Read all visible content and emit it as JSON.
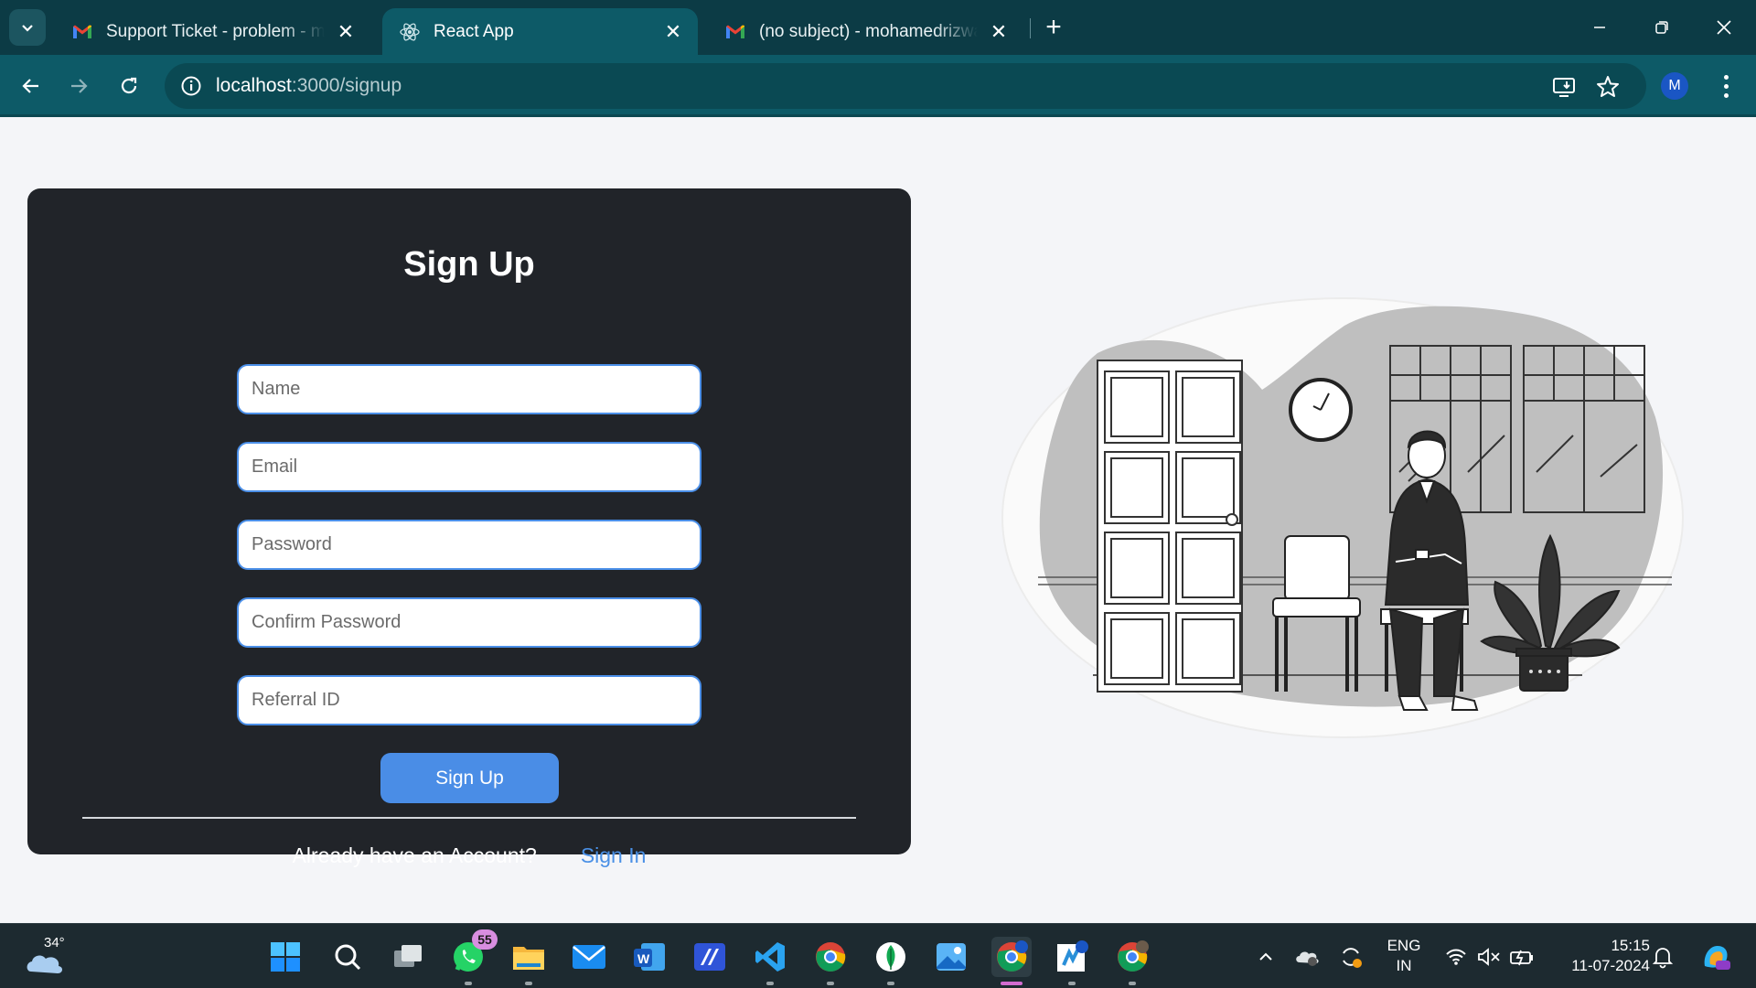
{
  "browser": {
    "tabs": [
      {
        "title": "Support Ticket - problem - mohamedrizwan",
        "favicon": "gmail-icon",
        "active": false
      },
      {
        "title": "React App",
        "favicon": "react-icon",
        "active": true
      },
      {
        "title": "(no subject) - mohamedrizwann",
        "favicon": "gmail-icon",
        "active": false
      }
    ],
    "new_tab_label": "+",
    "url_host": "localhost",
    "url_path": ":3000/signup",
    "profile_initial": "M"
  },
  "signup": {
    "title": "Sign Up",
    "fields": [
      {
        "placeholder": "Name",
        "type": "text"
      },
      {
        "placeholder": "Email",
        "type": "email"
      },
      {
        "placeholder": "Password",
        "type": "password"
      },
      {
        "placeholder": "Confirm Password",
        "type": "password"
      },
      {
        "placeholder": "Referral ID",
        "type": "text"
      }
    ],
    "submit_label": "Sign Up",
    "footer_question": "Already have an Account?",
    "footer_link": "Sign In"
  },
  "colors": {
    "chrome_dark": "#0c3b45",
    "chrome_toolbar": "#0d5a67",
    "card_bg": "#212429",
    "accent": "#4a8de6",
    "page_bg": "#f4f5f8"
  },
  "taskbar": {
    "weather_temp": "34°",
    "whatsapp_badge": "55",
    "language_line1": "ENG",
    "language_line2": "IN",
    "time": "15:15",
    "date": "11-07-2024",
    "apps": [
      "start-icon",
      "search-icon",
      "task-view-icon",
      "whatsapp-icon",
      "file-explorer-icon",
      "mail-icon",
      "word-icon",
      "app-icon",
      "vscode-icon",
      "chrome-icon",
      "mongodb-icon",
      "photos-icon",
      "chrome-icon",
      "app-icon",
      "chrome-icon"
    ]
  }
}
